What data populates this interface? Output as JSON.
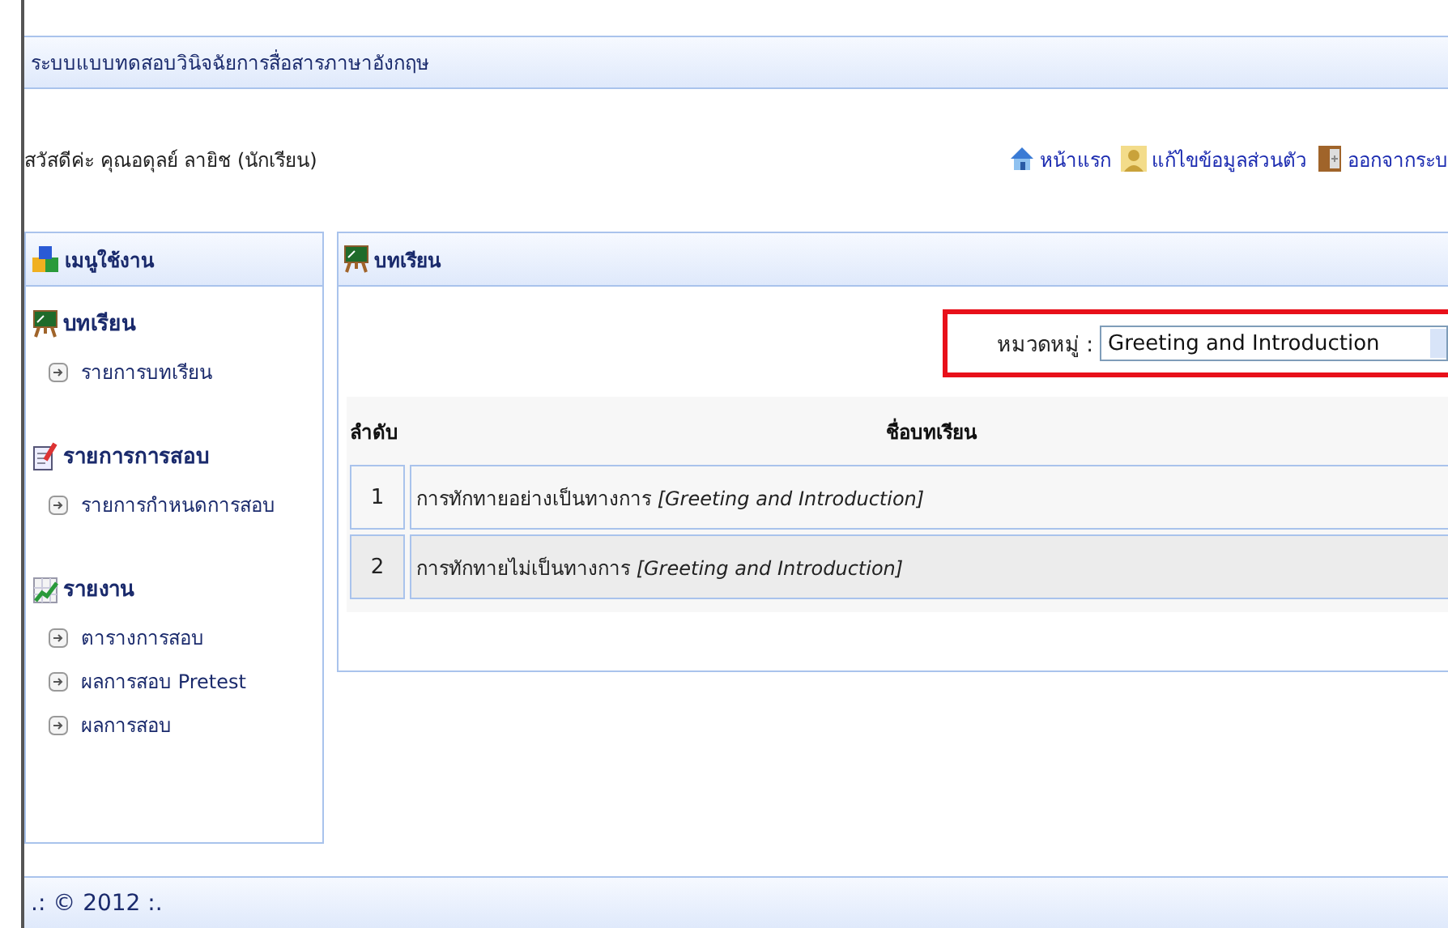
{
  "header": {
    "title": "ระบบแบบทดสอบวินิจฉัยการสื่อสารภาษาอังกฤษ"
  },
  "greeting": "สวัสดีค่ะ คุณอดุลย์ ลายิช (นักเรียน)",
  "top_links": [
    {
      "kind": "home",
      "label": "หน้าแรก"
    },
    {
      "kind": "profile",
      "label": "แก้ไขข้อมูลส่วนตัว"
    },
    {
      "kind": "logout",
      "label": "ออกจากระบ"
    }
  ],
  "sidebar": {
    "title": "เมนูใช้งาน",
    "sections": [
      {
        "kind": "lesson",
        "title": "บทเรียน",
        "items": [
          "รายการบทเรียน"
        ]
      },
      {
        "kind": "exam",
        "title": "รายการการสอบ",
        "items": [
          "รายการกำหนดการสอบ"
        ]
      },
      {
        "kind": "report",
        "title": "รายงาน",
        "items": [
          "ตารางการสอบ",
          "ผลการสอบ Pretest",
          "ผลการสอบ"
        ]
      }
    ]
  },
  "main": {
    "title": "บทเรียน",
    "filter": {
      "label": "หมวดหมู่ :",
      "value": "Greeting and Introduction",
      "highlighted": true
    },
    "table": {
      "columns": [
        "ลำดับ",
        "ชื่อบทเรียน"
      ],
      "rows": [
        {
          "no": "1",
          "name": "การทักทายอย่างเป็นทางการ *[Greeting and Introduction]*"
        },
        {
          "no": "2",
          "name": "การทักทายไม่เป็นทางการ *[Greeting and Introduction]*"
        }
      ]
    }
  },
  "footer": ".: © 2012 :."
}
